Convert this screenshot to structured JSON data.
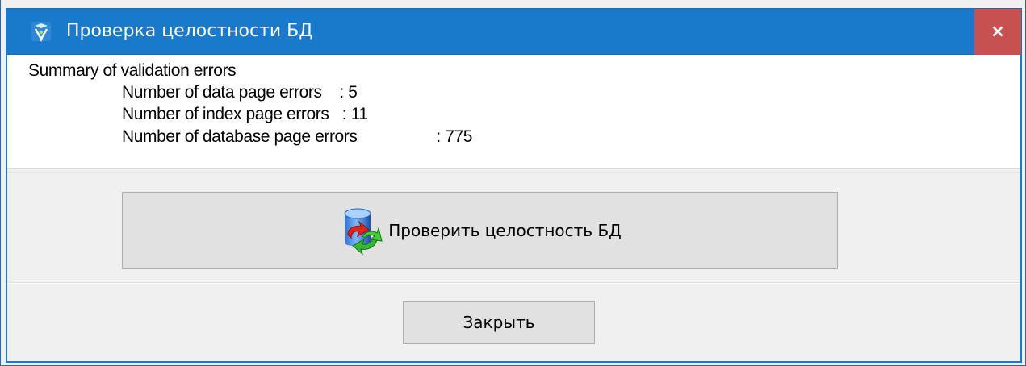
{
  "window": {
    "title": "Проверка целостности БД",
    "close_glyph": "×",
    "app_icon": "integrity-check-app-icon"
  },
  "summary": {
    "heading": "Summary of validation errors",
    "lines": [
      {
        "label": "Number of data page errors",
        "value": "5"
      },
      {
        "label": "Number of index page errors",
        "value": "11"
      },
      {
        "label": "Number of database page errors",
        "value": "775"
      }
    ]
  },
  "actions": {
    "check_label": "Проверить целостность БД",
    "check_icon": "database-refresh-icon",
    "close_label": "Закрыть"
  },
  "colors": {
    "titlebar": "#1979ca",
    "close_hover_red": "#c75050",
    "button_face": "#e1e1e1"
  }
}
